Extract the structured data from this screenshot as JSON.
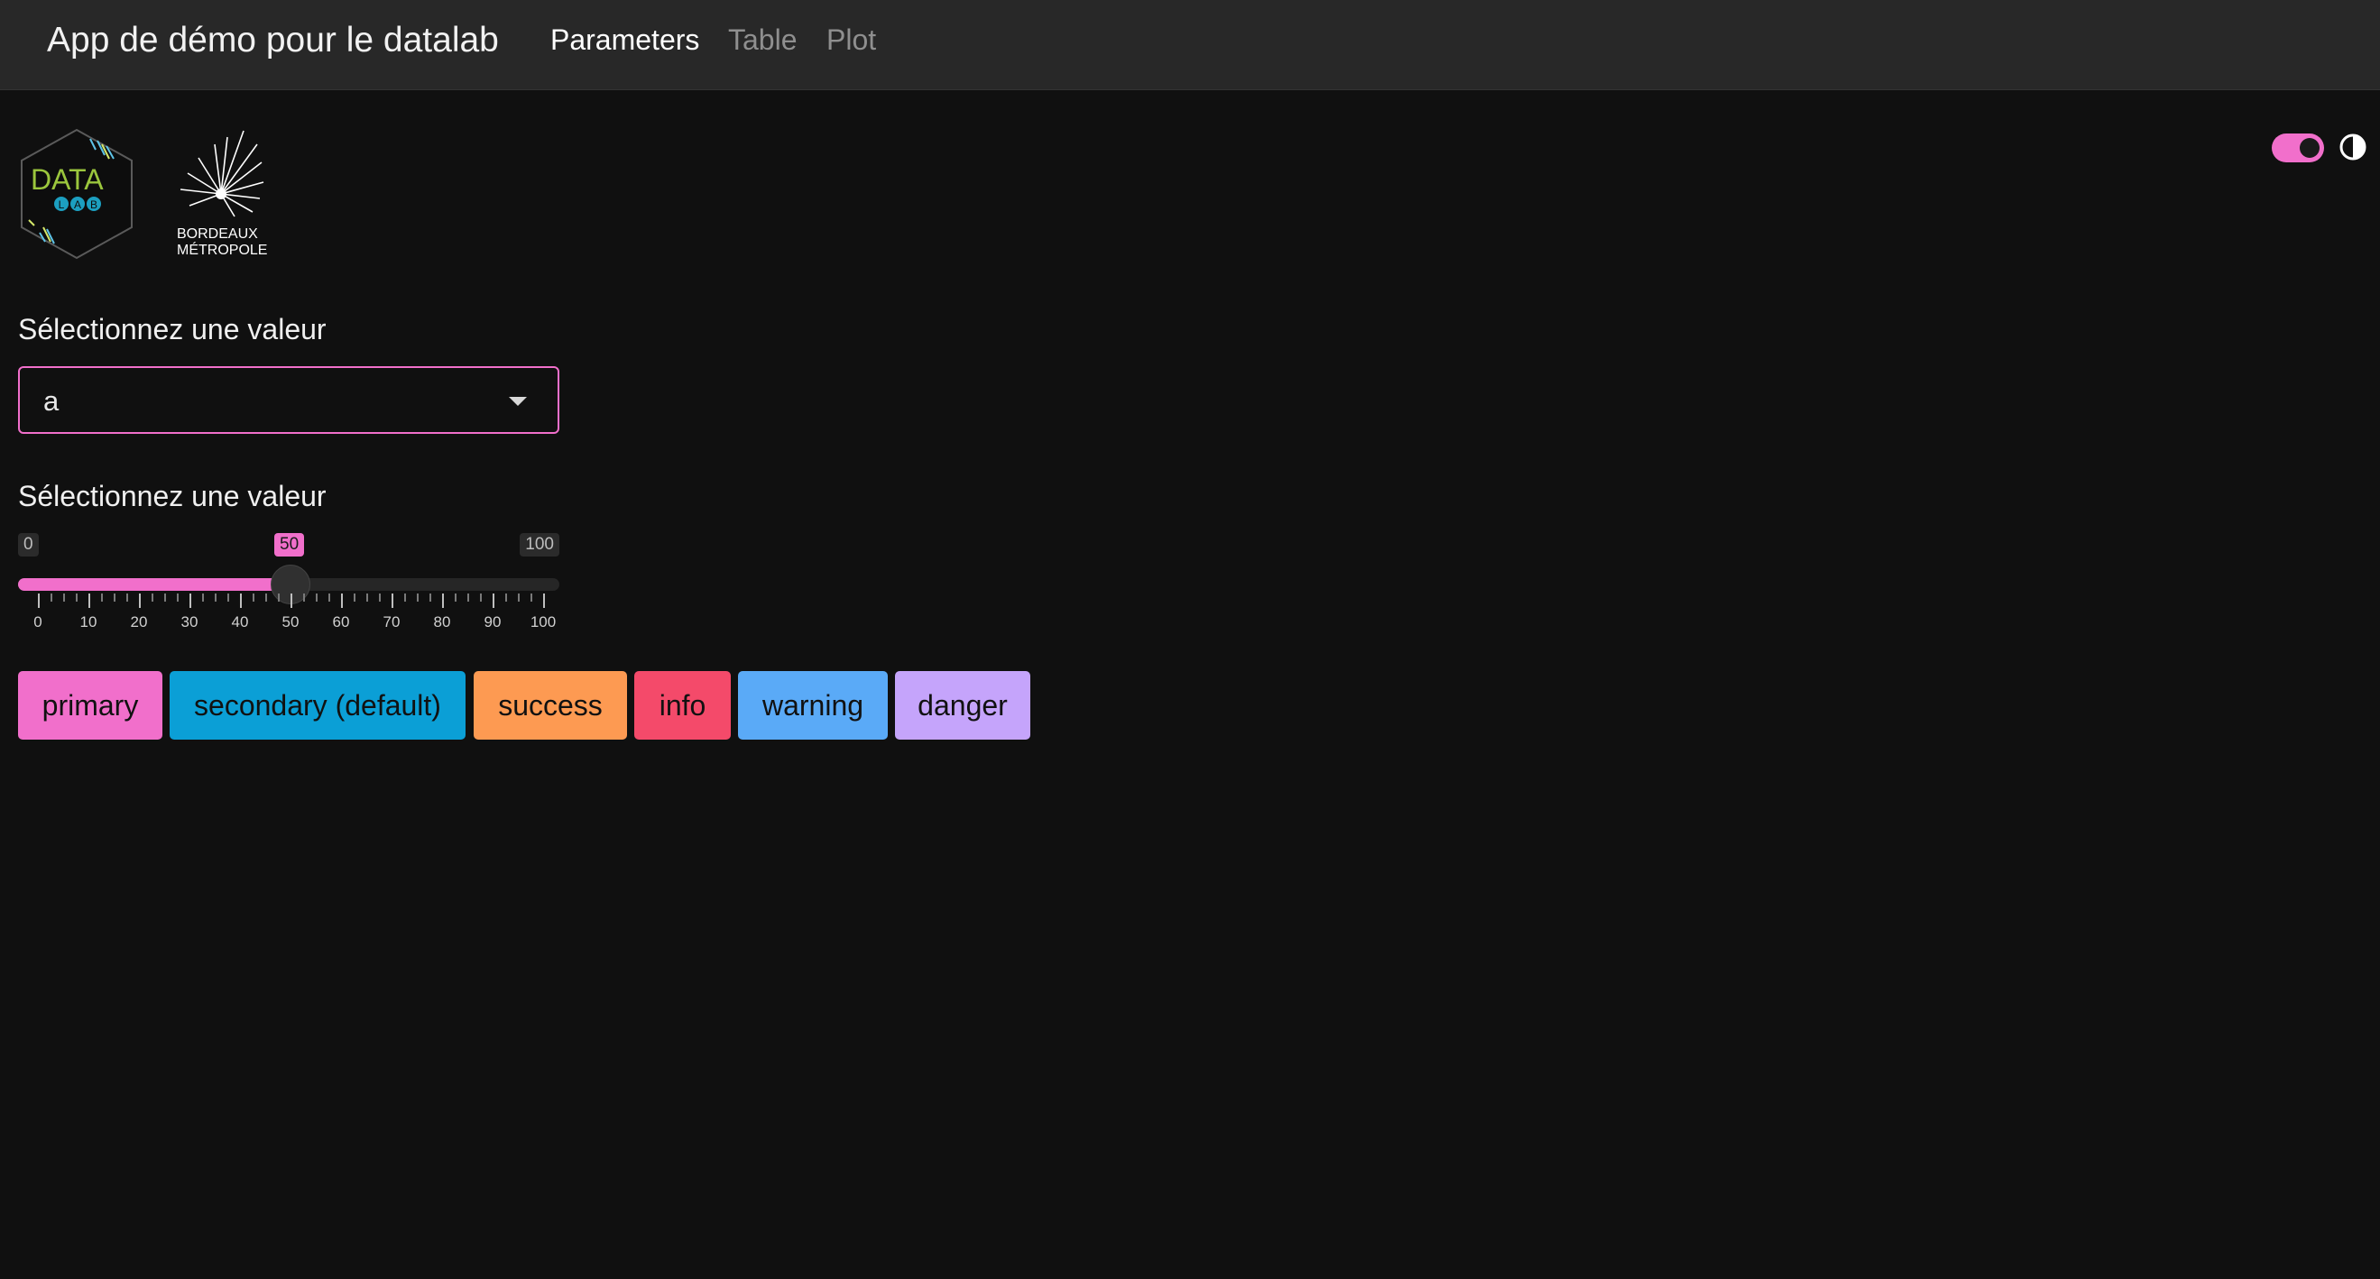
{
  "navbar": {
    "title": "App de démo pour le datalab",
    "tabs": [
      {
        "label": "Parameters",
        "active": true
      },
      {
        "label": "Table",
        "active": false
      },
      {
        "label": "Plot",
        "active": false
      }
    ]
  },
  "logos": {
    "datalab": {
      "text": "DATA",
      "sub": "LAB"
    },
    "bordeaux": {
      "line1": "BORDEAUX",
      "line2": "MÉTROPOLE"
    }
  },
  "theme_toggle": {
    "on": true,
    "icon": "contrast-icon"
  },
  "select_input": {
    "label": "Sélectionnez une valeur",
    "value": "a"
  },
  "slider_input": {
    "label": "Sélectionnez une valeur",
    "min": "0",
    "max": "100",
    "value": "50",
    "tick_labels": [
      "0",
      "10",
      "20",
      "30",
      "40",
      "50",
      "60",
      "70",
      "80",
      "90",
      "100"
    ]
  },
  "buttons": [
    {
      "label": "primary",
      "color": "#f16fcb"
    },
    {
      "label": "secondary (default)",
      "color": "#0b9fd6"
    },
    {
      "label": "success",
      "color": "#fd9a52"
    },
    {
      "label": "info",
      "color": "#f44a6a"
    },
    {
      "label": "warning",
      "color": "#5aaaf7"
    },
    {
      "label": "danger",
      "color": "#c5a4fb"
    }
  ],
  "colors": {
    "accent": "#f16fcb",
    "background": "#101010",
    "navbar": "#282828"
  }
}
